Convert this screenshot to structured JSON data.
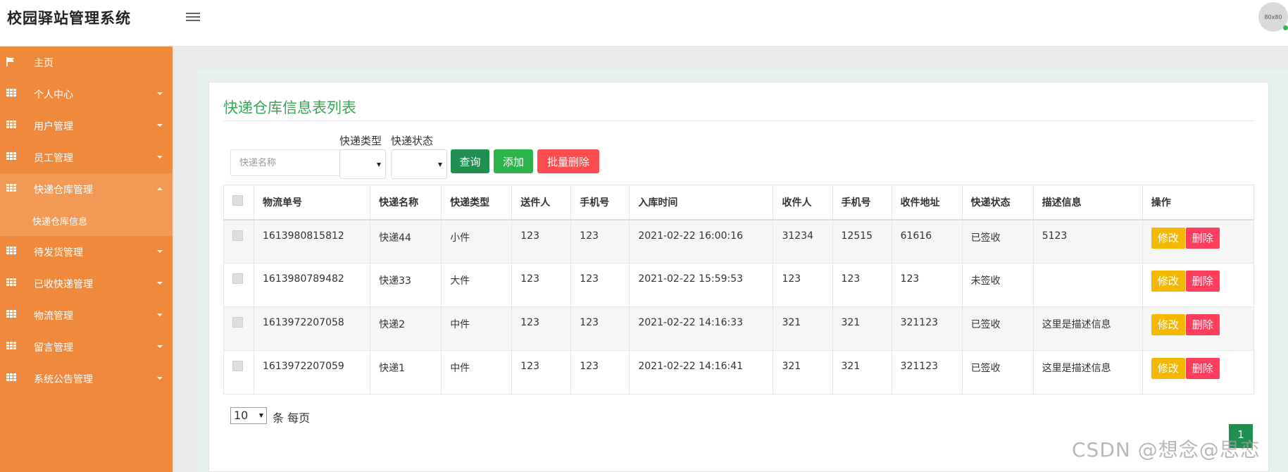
{
  "app": {
    "title": "校园驿站管理系统",
    "avatar_text": "80x80"
  },
  "sidebar": {
    "items": [
      {
        "label": "主页",
        "icon": "flag-icon",
        "has_caret": false
      },
      {
        "label": "个人中心",
        "icon": "grid-icon",
        "has_caret": true
      },
      {
        "label": "用户管理",
        "icon": "grid-icon",
        "has_caret": true
      },
      {
        "label": "员工管理",
        "icon": "grid-icon",
        "has_caret": true
      },
      {
        "label": "快递仓库管理",
        "icon": "grid-icon",
        "has_caret": true,
        "expanded": true,
        "sub_items": [
          "快递仓库信息"
        ]
      },
      {
        "label": "待发货管理",
        "icon": "grid-icon",
        "has_caret": true
      },
      {
        "label": "已收快递管理",
        "icon": "grid-icon",
        "has_caret": true
      },
      {
        "label": "物流管理",
        "icon": "grid-icon",
        "has_caret": true
      },
      {
        "label": "留言管理",
        "icon": "grid-icon",
        "has_caret": true
      },
      {
        "label": "系统公告管理",
        "icon": "grid-icon",
        "has_caret": true
      }
    ]
  },
  "page": {
    "title": "快递仓库信息表列表",
    "search": {
      "name_placeholder": "快递名称",
      "type_label": "快递类型",
      "status_label": "快递状态",
      "query_btn": "查询",
      "add_btn": "添加",
      "batch_delete_btn": "批量删除"
    },
    "table": {
      "headers": [
        "物流单号",
        "快递名称",
        "快递类型",
        "送件人",
        "手机号",
        "入库时间",
        "收件人",
        "手机号",
        "收件地址",
        "快递状态",
        "描述信息",
        "操作"
      ],
      "rows": [
        [
          "1613980815812",
          "快递44",
          "小件",
          "123",
          "123",
          "2021-02-22 16:00:16",
          "31234",
          "12515",
          "61616",
          "已签收",
          "5123"
        ],
        [
          "1613980789482",
          "快递33",
          "大件",
          "123",
          "123",
          "2021-02-22 15:59:53",
          "123",
          "123",
          "123",
          "未签收",
          ""
        ],
        [
          "1613972207058",
          "快递2",
          "中件",
          "123",
          "123",
          "2021-02-22 14:16:33",
          "321",
          "321",
          "321123",
          "已签收",
          "这里是描述信息"
        ],
        [
          "1613972207059",
          "快递1",
          "中件",
          "123",
          "123",
          "2021-02-22 14:16:41",
          "321",
          "321",
          "321123",
          "已签收",
          "这里是描述信息"
        ]
      ],
      "edit_label": "修改",
      "delete_label": "删除"
    },
    "pagination": {
      "page_size": "10",
      "per_page_text": "条 每页",
      "current_page": "1"
    }
  },
  "watermark": "CSDN @想念@思恋",
  "colors": {
    "sidebar": "#ef8a3c",
    "title_green": "#3aa657",
    "query": "#1f8f52",
    "add": "#2db34a",
    "batch_delete": "#ff4d4f",
    "edit": "#f5b800",
    "delete": "#ff3d5d"
  }
}
